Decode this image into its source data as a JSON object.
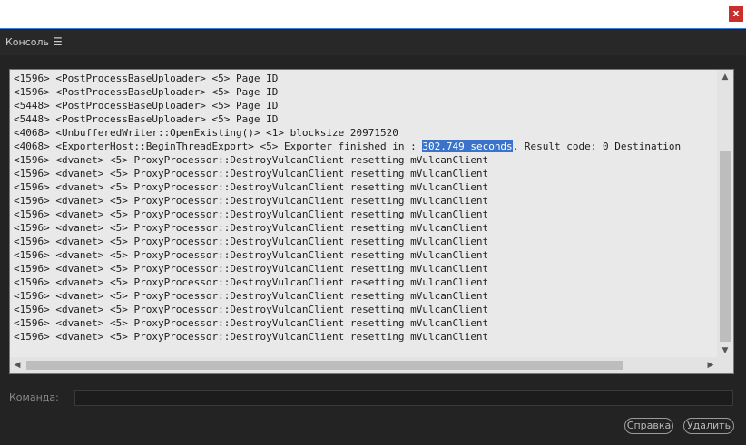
{
  "window": {
    "close_label": "x"
  },
  "panel": {
    "title": "Консоль",
    "menu_glyph": "☰"
  },
  "log": {
    "lines": [
      {
        "text": "<1596> <PostProcessBaseUploader> <5> Page ID"
      },
      {
        "text": "<1596> <PostProcessBaseUploader> <5> Page ID"
      },
      {
        "text": "<5448> <PostProcessBaseUploader> <5> Page ID"
      },
      {
        "text": "<5448> <PostProcessBaseUploader> <5> Page ID"
      },
      {
        "text": "<4068> <UnbufferedWriter::OpenExisting()> <1> blocksize 20971520"
      },
      {
        "before": "<4068> <ExporterHost::BeginThreadExport> <5> Exporter finished in : ",
        "selected": "302.749 seconds",
        "after": ". Result code: 0 Destination"
      },
      {
        "text": "<1596> <dvanet> <5> ProxyProcessor::DestroyVulcanClient resetting mVulcanClient"
      },
      {
        "text": "<1596> <dvanet> <5> ProxyProcessor::DestroyVulcanClient resetting mVulcanClient"
      },
      {
        "text": "<1596> <dvanet> <5> ProxyProcessor::DestroyVulcanClient resetting mVulcanClient"
      },
      {
        "text": "<1596> <dvanet> <5> ProxyProcessor::DestroyVulcanClient resetting mVulcanClient"
      },
      {
        "text": "<1596> <dvanet> <5> ProxyProcessor::DestroyVulcanClient resetting mVulcanClient"
      },
      {
        "text": "<1596> <dvanet> <5> ProxyProcessor::DestroyVulcanClient resetting mVulcanClient"
      },
      {
        "text": "<1596> <dvanet> <5> ProxyProcessor::DestroyVulcanClient resetting mVulcanClient"
      },
      {
        "text": "<1596> <dvanet> <5> ProxyProcessor::DestroyVulcanClient resetting mVulcanClient"
      },
      {
        "text": "<1596> <dvanet> <5> ProxyProcessor::DestroyVulcanClient resetting mVulcanClient"
      },
      {
        "text": "<1596> <dvanet> <5> ProxyProcessor::DestroyVulcanClient resetting mVulcanClient"
      },
      {
        "text": "<1596> <dvanet> <5> ProxyProcessor::DestroyVulcanClient resetting mVulcanClient"
      },
      {
        "text": "<1596> <dvanet> <5> ProxyProcessor::DestroyVulcanClient resetting mVulcanClient"
      },
      {
        "text": "<1596> <dvanet> <5> ProxyProcessor::DestroyVulcanClient resetting mVulcanClient"
      },
      {
        "text": "<1596> <dvanet> <5> ProxyProcessor::DestroyVulcanClient resetting mVulcanClient"
      }
    ]
  },
  "command": {
    "label": "Команда:",
    "value": ""
  },
  "buttons": {
    "help": "Справка",
    "delete": "Удалить"
  },
  "colors": {
    "accent": "#3b84d6",
    "selection": "#3a73c9",
    "close": "#c9302c"
  },
  "icons": {
    "close": "close-icon",
    "menu": "hamburger-menu-icon",
    "scroll_up": "chevron-up-icon",
    "scroll_down": "chevron-down-icon",
    "scroll_left": "chevron-left-icon",
    "scroll_right": "chevron-right-icon"
  }
}
